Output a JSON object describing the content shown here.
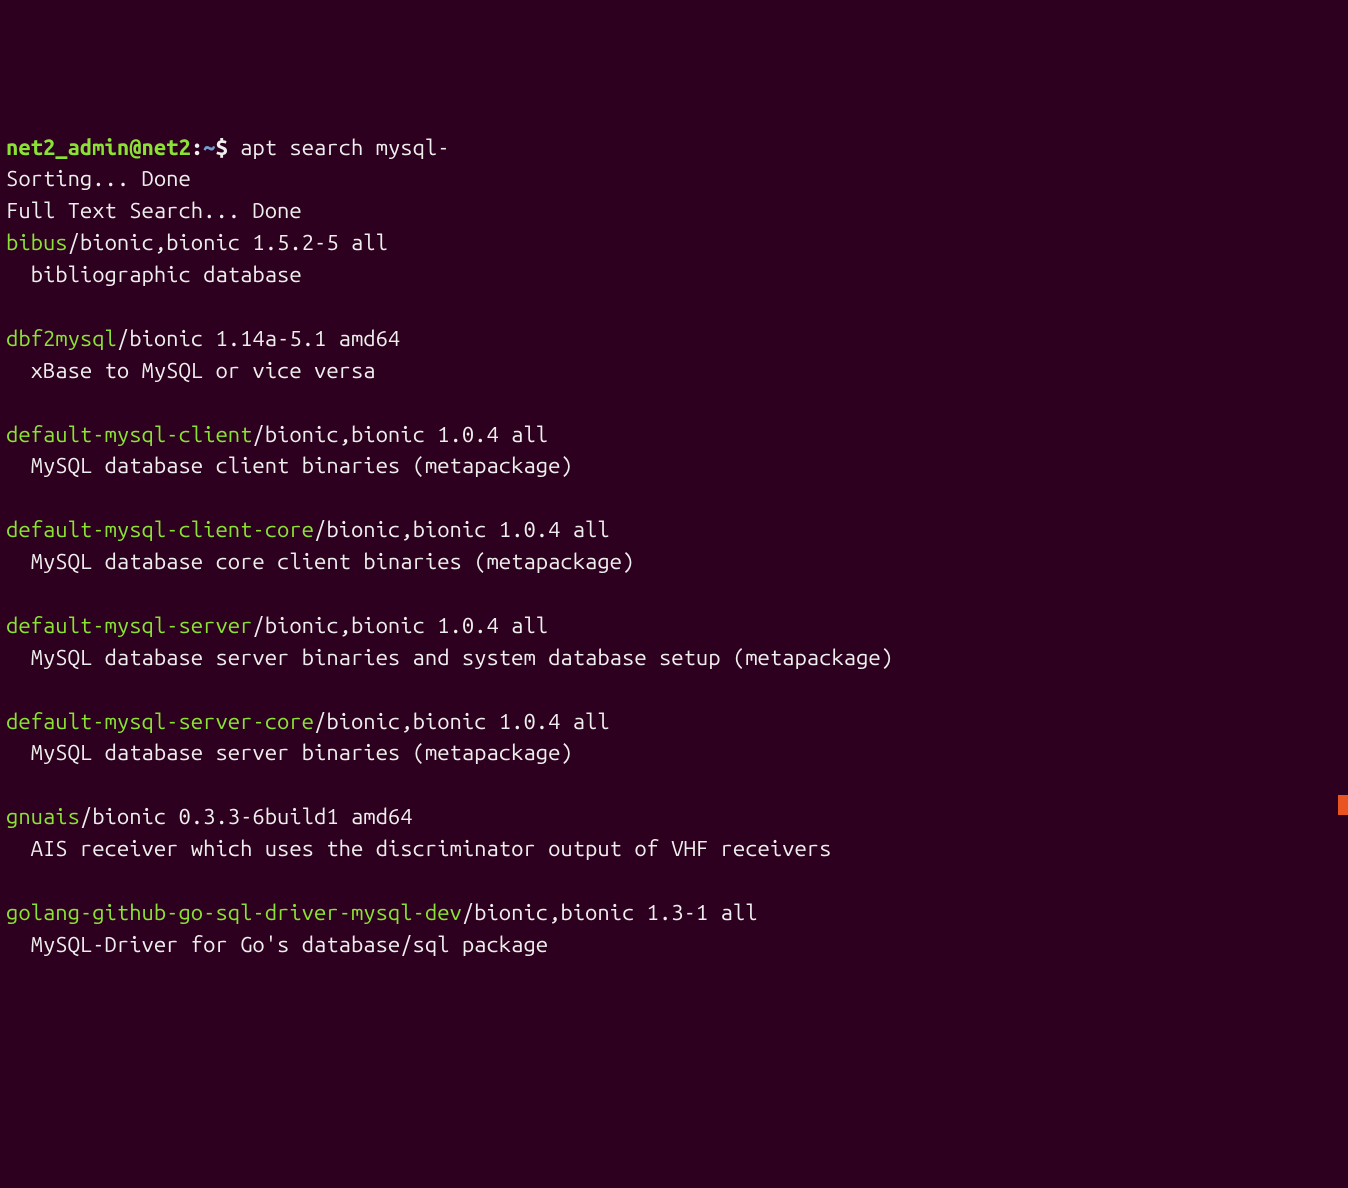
{
  "prompt": {
    "user_host": "net2_admin@net2",
    "separator1": ":",
    "path": "~",
    "separator2": "$ ",
    "command": "apt search mysql-"
  },
  "status_lines": [
    "Sorting... Done",
    "Full Text Search... Done"
  ],
  "packages": [
    {
      "name": "bibus",
      "meta": "/bionic,bionic 1.5.2-5 all",
      "desc": "  bibliographic database"
    },
    {
      "name": "dbf2mysql",
      "meta": "/bionic 1.14a-5.1 amd64",
      "desc": "  xBase to MySQL or vice versa"
    },
    {
      "name": "default-mysql-client",
      "meta": "/bionic,bionic 1.0.4 all",
      "desc": "  MySQL database client binaries (metapackage)"
    },
    {
      "name": "default-mysql-client-core",
      "meta": "/bionic,bionic 1.0.4 all",
      "desc": "  MySQL database core client binaries (metapackage)"
    },
    {
      "name": "default-mysql-server",
      "meta": "/bionic,bionic 1.0.4 all",
      "desc": "  MySQL database server binaries and system database setup (metapackage)"
    },
    {
      "name": "default-mysql-server-core",
      "meta": "/bionic,bionic 1.0.4 all",
      "desc": "  MySQL database server binaries (metapackage)"
    },
    {
      "name": "gnuais",
      "meta": "/bionic 0.3.3-6build1 amd64",
      "desc": "  AIS receiver which uses the discriminator output of VHF receivers"
    },
    {
      "name": "golang-github-go-sql-driver-mysql-dev",
      "meta": "/bionic,bionic 1.3-1 all",
      "desc": "  MySQL-Driver for Go's database/sql package"
    }
  ]
}
